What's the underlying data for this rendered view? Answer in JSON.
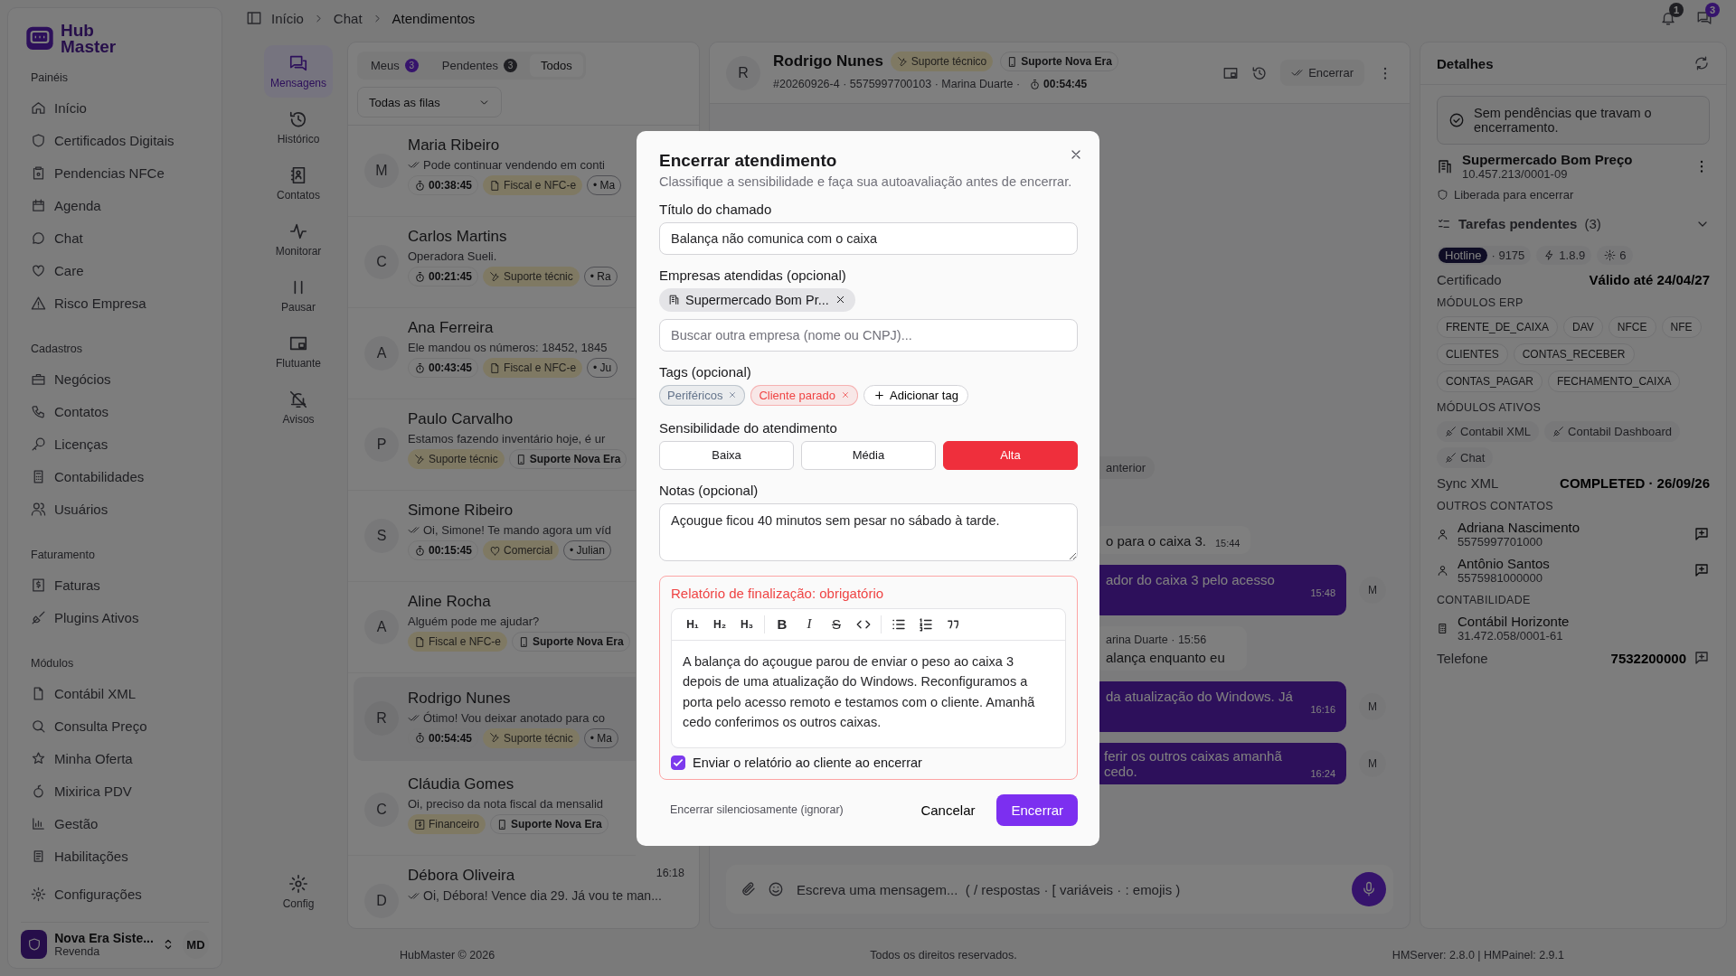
{
  "sidebar": {
    "logo": [
      "Hub",
      "Master"
    ],
    "sections": [
      {
        "title": "Painéis",
        "items": [
          {
            "label": "Início"
          },
          {
            "label": "Certificados Digitais"
          },
          {
            "label": "Pendencias NFCe"
          },
          {
            "label": "Agenda"
          },
          {
            "label": "Chat"
          },
          {
            "label": "Care"
          },
          {
            "label": "Risco Empresa"
          }
        ]
      },
      {
        "title": "Cadastros",
        "items": [
          {
            "label": "Negócios"
          },
          {
            "label": "Contatos"
          },
          {
            "label": "Licenças"
          },
          {
            "label": "Contabilidades"
          },
          {
            "label": "Usuários"
          }
        ]
      },
      {
        "title": "Faturamento",
        "items": [
          {
            "label": "Faturas"
          },
          {
            "label": "Plugins Ativos"
          }
        ]
      },
      {
        "title": "Módulos",
        "items": [
          {
            "label": "Contábil XML"
          },
          {
            "label": "Consulta Preço"
          },
          {
            "label": "Minha Oferta"
          },
          {
            "label": "Mixirica PDV"
          },
          {
            "label": "Gestão"
          },
          {
            "label": "Habilitações"
          }
        ]
      }
    ],
    "settings": "Configurações",
    "account": {
      "name": "Nova Era Siste...",
      "role": "Revenda",
      "initials": "MD"
    }
  },
  "topbar": {
    "breadcrumb": [
      "Início",
      "Chat",
      "Atendimentos"
    ],
    "notifications": "1",
    "messages": "3"
  },
  "rail": {
    "items": [
      {
        "label": "Mensagens",
        "selected": true
      },
      {
        "label": "Histórico",
        "selected": false
      },
      {
        "label": "Contatos",
        "selected": false
      },
      {
        "label": "Monitorar",
        "selected": false
      },
      {
        "label": "Pausar",
        "selected": false
      },
      {
        "label": "Flutuante",
        "selected": false
      },
      {
        "label": "Avisos",
        "selected": false
      }
    ],
    "settings": {
      "label": "Config",
      "selected": false
    }
  },
  "queue": {
    "tabs": [
      {
        "label": "Meus",
        "count": "3",
        "selected": false
      },
      {
        "label": "Pendentes",
        "count": "3",
        "selected": false
      },
      {
        "label": "Todos",
        "selected": true
      }
    ],
    "filter": "Todas as filas",
    "conversations": [
      {
        "initial": "M",
        "name": "Maria Ribeiro",
        "read": true,
        "preview": "Pode continuar vendendo em conti",
        "timer": "00:38:45",
        "tags": [
          {
            "kind": "fiscal",
            "label": "Fiscal e NFC-e"
          },
          {
            "kind": "agent",
            "label": "• Ma"
          }
        ],
        "selected": false
      },
      {
        "initial": "C",
        "name": "Carlos Martins",
        "read": false,
        "preview": "Operadora Sueli.",
        "timer": "00:21:45",
        "tags": [
          {
            "kind": "support",
            "label": "Suporte técnic"
          },
          {
            "kind": "agent",
            "label": "• Ra"
          }
        ],
        "selected": false
      },
      {
        "initial": "A",
        "name": "Ana Ferreira",
        "read": false,
        "preview": "Ele mandou os números: 18452, 1845",
        "timer": "00:43:45",
        "tags": [
          {
            "kind": "fiscal",
            "label": "Fiscal e NFC-e"
          },
          {
            "kind": "agent",
            "label": "• Ju"
          }
        ],
        "selected": false
      },
      {
        "initial": "P",
        "name": "Paulo Carvalho",
        "read": false,
        "preview": "Estamos fazendo inventário hoje, é ur",
        "tags": [
          {
            "kind": "support",
            "label": "Suporte técnic"
          },
          {
            "kind": "queue",
            "label": "Suporte Nova Era"
          }
        ],
        "selected": false
      },
      {
        "initial": "S",
        "name": "Simone Ribeiro",
        "read": true,
        "preview": "Oi, Simone! Te mando agora um víd",
        "timer": "00:15:45",
        "tags": [
          {
            "kind": "commercial",
            "label": "Comercial"
          },
          {
            "kind": "agent",
            "label": "• Julian"
          }
        ],
        "selected": false
      },
      {
        "initial": "A",
        "name": "Aline Rocha",
        "read": false,
        "preview": "Alguém pode me ajudar?",
        "tags": [
          {
            "kind": "fiscal",
            "label": "Fiscal e NFC-e"
          },
          {
            "kind": "queue",
            "label": "Suporte Nova Era"
          }
        ],
        "selected": false
      },
      {
        "initial": "R",
        "name": "Rodrigo Nunes",
        "read": true,
        "preview": "Ótimo! Vou deixar anotado para co",
        "timer": "00:54:45",
        "tags": [
          {
            "kind": "support",
            "label": "Suporte técnic"
          },
          {
            "kind": "agent",
            "label": "• Ma"
          }
        ],
        "selected": true
      },
      {
        "initial": "C",
        "name": "Cláudia Gomes",
        "read": false,
        "preview": "Oi, preciso da nota fiscal da mensalid",
        "tags": [
          {
            "kind": "finance",
            "label": "Financeiro"
          },
          {
            "kind": "queue",
            "label": "Suporte Nova Era"
          }
        ],
        "selected": false
      },
      {
        "initial": "D",
        "name": "Débora Oliveira",
        "time": "16:18",
        "read": true,
        "preview": "Oi, Débora! Vence dia 29. Já vou te man...",
        "selected": false
      }
    ]
  },
  "chat": {
    "initial": "R",
    "name": "Rodrigo Nunes",
    "tags": [
      {
        "kind": "support",
        "label": "Suporte técnico"
      },
      {
        "kind": "queue",
        "label": "Suporte Nova Era"
      }
    ],
    "meta": "#20260926-4 · 5575997700103 · Marina Duarte ·",
    "timer": "00:54:45",
    "close_label": "Encerrar",
    "messages": [
      {
        "kind": "pill",
        "text": "anterior"
      },
      {
        "kind": "in",
        "text": "o para o caixa 3.",
        "time": "15:44"
      },
      {
        "kind": "out",
        "text": "ador do caixa 3 pelo acesso",
        "time": "15:48",
        "avatar": "M"
      },
      {
        "kind": "in",
        "sender": "arina Duarte · 15:56",
        "text": "alança enquanto eu"
      },
      {
        "kind": "out",
        "text": "da atualização do Windows. Já",
        "time": "16:16",
        "avatar": "M"
      },
      {
        "kind": "out",
        "text": "ferir os outros caixas amanhã cedo.",
        "time": "16:24",
        "avatar": "M"
      }
    ],
    "composer": {
      "placeholder": "Escreva uma mensagem...  ( / respostas · [ variáveis · : emojis )"
    }
  },
  "details": {
    "title": "Detalhes",
    "alert": "Sem pendências que travam o encerramento.",
    "company": {
      "name": "Supermercado Bom Preço",
      "cnpj": "10.457.213/0001-09",
      "status": "Liberada para encerrar"
    },
    "tasks": {
      "label": "Tarefas pendentes",
      "count": "(3)"
    },
    "badges": {
      "plan": "Hotline",
      "plan_id": "· 9175",
      "version": "1.8.9",
      "count": "6"
    },
    "certificate": {
      "label": "Certificado",
      "value": "Válido até 24/04/27"
    },
    "erp": {
      "title": "MÓDULOS ERP",
      "modules": [
        "FRENTE_DE_CAIXA",
        "DAV",
        "NFCE",
        "NFE",
        "CLIENTES",
        "CONTAS_RECEBER",
        "CONTAS_PAGAR",
        "FECHAMENTO_CAIXA"
      ]
    },
    "active": {
      "title": "MÓDULOS ATIVOS",
      "modules": [
        "Contabil XML",
        "Contabil Dashboard",
        "Chat"
      ]
    },
    "sync": {
      "label": "Sync XML",
      "value": "COMPLETED · 26/09/26"
    },
    "contacts": {
      "title": "OUTROS CONTATOS",
      "items": [
        {
          "name": "Adriana Nascimento",
          "phone": "5575997701000"
        },
        {
          "name": "Antônio Santos",
          "phone": "5575981000000"
        }
      ]
    },
    "accounting": {
      "title": "CONTABILIDADE",
      "name": "Contábil Horizonte",
      "cnpj": "31.472.058/0001-61"
    },
    "phone": {
      "label": "Telefone",
      "value": "7532200000"
    }
  },
  "footer": [
    "HubMaster © 2026",
    "Todos os direitos reservados.",
    "HMServer: 2.8.0 | HMPainel: 2.9.1"
  ],
  "modal": {
    "title": "Encerrar atendimento",
    "subtitle": "Classifique a sensibilidade e faça sua autoavaliação antes de encerrar.",
    "ticket": {
      "label": "Título do chamado",
      "value": "Balança não comunica com o caixa"
    },
    "companies": {
      "label": "Empresas atendidas (opcional)",
      "chips": [
        "Supermercado Bom Pr..."
      ],
      "placeholder": "Buscar outra empresa (nome ou CNPJ)..."
    },
    "tags": {
      "label": "Tags (opcional)",
      "items": [
        {
          "label": "Periféricos",
          "color": "#64748b"
        },
        {
          "label": "Cliente parado",
          "color": "#ef4444"
        }
      ],
      "add": "Adicionar tag"
    },
    "sensitivity": {
      "label": "Sensibilidade do atendimento",
      "options": [
        {
          "label": "Baixa",
          "selected": false
        },
        {
          "label": "Média",
          "selected": false
        },
        {
          "label": "Alta",
          "selected": true
        }
      ]
    },
    "notes": {
      "label": "Notas (opcional)",
      "value": "Açougue ficou 40 minutos sem pesar no sábado à tarde."
    },
    "report": {
      "label": "Relatório de finalização: obrigatório",
      "headings": [
        "H₁",
        "H₂",
        "H₃"
      ],
      "formats": [
        "B",
        "I",
        "S"
      ],
      "text": "A balança do açougue parou de enviar o peso ao caixa 3 depois de uma atualização do Windows. Reconfiguramos a porta pelo acesso remoto e testamos com o cliente. Amanhã cedo conferimos os outros caixas.",
      "send": {
        "label": "Enviar o relatório ao cliente ao encerrar",
        "checked": true
      }
    },
    "silent": "Encerrar silenciosamente (ignorar)",
    "cancel": "Cancelar",
    "confirm": "Encerrar"
  }
}
